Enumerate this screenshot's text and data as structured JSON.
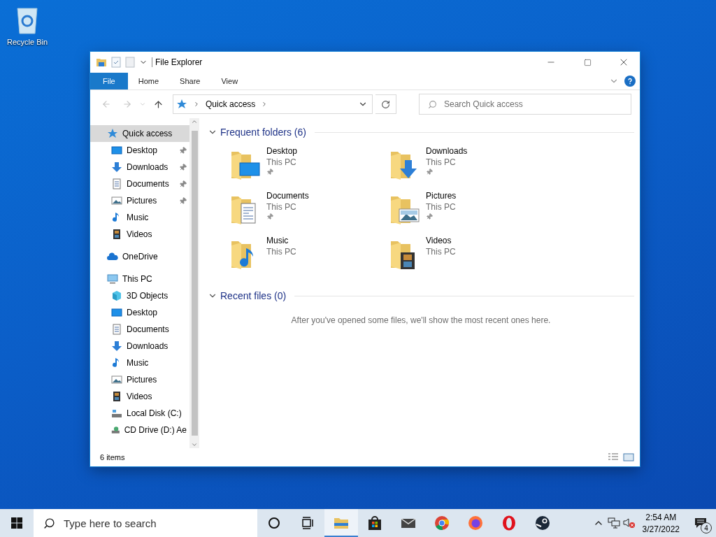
{
  "desktop_icons": [
    {
      "label": "Recycle Bin"
    }
  ],
  "window": {
    "title": "File Explorer",
    "ribbon_tabs": [
      {
        "label": "File",
        "selected": true
      },
      {
        "label": "Home",
        "selected": false
      },
      {
        "label": "Share",
        "selected": false
      },
      {
        "label": "View",
        "selected": false
      }
    ],
    "address": {
      "path": "Quick access"
    },
    "search": {
      "placeholder": "Search Quick access"
    },
    "nav_pane": [
      {
        "label": "Quick access",
        "kind": "star",
        "selected": true,
        "children": [
          {
            "label": "Desktop",
            "kind": "desktop",
            "selected": false,
            "pinned": true
          },
          {
            "label": "Downloads",
            "kind": "downloads",
            "selected": false,
            "pinned": true
          },
          {
            "label": "Documents",
            "kind": "documents",
            "selected": false,
            "pinned": true
          },
          {
            "label": "Pictures",
            "kind": "pictures",
            "selected": false,
            "pinned": true
          },
          {
            "label": "Music",
            "kind": "music",
            "selected": false,
            "pinned": false
          },
          {
            "label": "Videos",
            "kind": "videos",
            "selected": false,
            "pinned": false
          }
        ]
      },
      {
        "label": "OneDrive",
        "kind": "cloud",
        "selected": false
      },
      {
        "label": "This PC",
        "kind": "pc",
        "selected": false,
        "children": [
          {
            "label": "3D Objects",
            "kind": "cube",
            "selected": false,
            "pinned": false
          },
          {
            "label": "Desktop",
            "kind": "desktop",
            "selected": false,
            "pinned": false
          },
          {
            "label": "Documents",
            "kind": "documents",
            "selected": false,
            "pinned": false
          },
          {
            "label": "Downloads",
            "kind": "downloads",
            "selected": false,
            "pinned": false
          },
          {
            "label": "Music",
            "kind": "music",
            "selected": false,
            "pinned": false
          },
          {
            "label": "Pictures",
            "kind": "pictures",
            "selected": false,
            "pinned": false
          },
          {
            "label": "Videos",
            "kind": "videos",
            "selected": false,
            "pinned": false
          },
          {
            "label": "Local Disk (C:)",
            "kind": "disk",
            "selected": false,
            "pinned": false
          },
          {
            "label": "CD Drive (D:) Ae",
            "kind": "cd",
            "selected": false,
            "pinned": false
          }
        ]
      }
    ],
    "frequent_folders": {
      "title": "Frequent folders (6)",
      "expanded": true,
      "items": [
        {
          "name": "Desktop",
          "location": "This PC",
          "kind": "desktop",
          "pinned": true
        },
        {
          "name": "Downloads",
          "location": "This PC",
          "kind": "downloads",
          "pinned": true
        },
        {
          "name": "Documents",
          "location": "This PC",
          "kind": "documents",
          "pinned": true
        },
        {
          "name": "Pictures",
          "location": "This PC",
          "kind": "pictures",
          "pinned": true
        },
        {
          "name": "Music",
          "location": "This PC",
          "kind": "music",
          "pinned": false
        },
        {
          "name": "Videos",
          "location": "This PC",
          "kind": "videos",
          "pinned": false
        }
      ]
    },
    "recent_files": {
      "title": "Recent files (0)",
      "expanded": true,
      "empty_message": "After you've opened some files, we'll show the most recent ones here."
    },
    "status_bar": {
      "item_count": "6 items"
    }
  },
  "taskbar": {
    "search": {
      "placeholder": "Type here to search"
    },
    "apps": [
      {
        "kind": "explorer",
        "active": true
      },
      {
        "kind": "store",
        "active": false
      },
      {
        "kind": "mail",
        "active": false
      },
      {
        "kind": "chrome",
        "active": false
      },
      {
        "kind": "firefox",
        "active": false
      },
      {
        "kind": "opera",
        "active": false
      },
      {
        "kind": "steam",
        "active": false
      }
    ],
    "clock": {
      "time": "2:54 AM",
      "date": "3/27/2022"
    },
    "notifications": {
      "count": "4"
    }
  }
}
